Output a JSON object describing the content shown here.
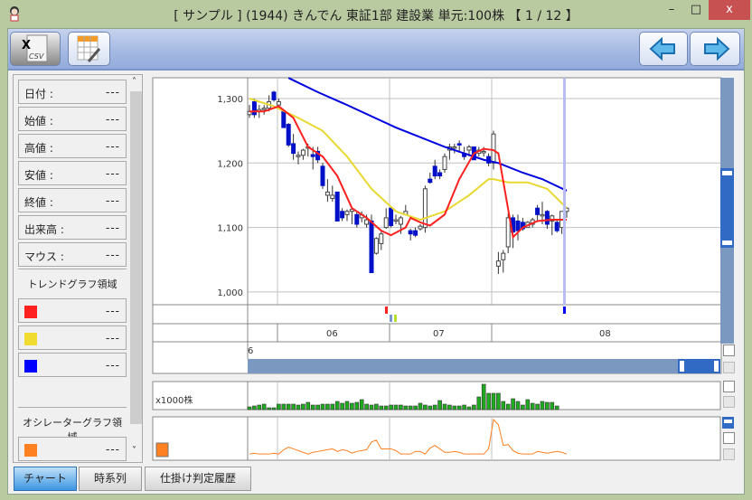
{
  "window": {
    "title": "[ サンプル ] (1944) きんでん 東証1部 建設業 単元:100株 【 1 / 12 】",
    "min": "–",
    "max": "□",
    "close": "x"
  },
  "toolbar": {
    "buttons": [
      {
        "name": "csv-export",
        "icon": "excel-csv-icon",
        "label": "CSV"
      },
      {
        "name": "table",
        "icon": "spreadsheet-edit-icon"
      },
      {
        "name": "prev",
        "icon": "arrow-left-icon"
      },
      {
        "name": "next",
        "icon": "arrow-right-icon"
      }
    ]
  },
  "info": {
    "fields": [
      {
        "label": "日付 :",
        "value": "---"
      },
      {
        "label": "始値 :",
        "value": "---"
      },
      {
        "label": "高値 :",
        "value": "---"
      },
      {
        "label": "安値 :",
        "value": "---"
      },
      {
        "label": "終値 :",
        "value": "---"
      },
      {
        "label": "出来高 :",
        "value": "---"
      },
      {
        "label": "マウス :",
        "value": "---"
      }
    ],
    "trend_title": "トレンドグラフ領域",
    "trend": [
      {
        "color": "#ff2020",
        "value": "---"
      },
      {
        "color": "#f0dc30",
        "value": "---"
      },
      {
        "color": "#0000ff",
        "value": "---"
      }
    ],
    "osc_title": "オシレーターグラフ領域",
    "osc": [
      {
        "color": "#ff8020",
        "value": "---"
      }
    ]
  },
  "chart": {
    "y_ticks": [
      "1,300",
      "1,200",
      "1,100",
      "1,000"
    ],
    "y_values": [
      1300,
      1200,
      1100,
      1000
    ],
    "months": [
      "06",
      "07",
      "08"
    ],
    "year": "6",
    "volume_label": "x1000株",
    "colors": {
      "ma_short": "#ff2020",
      "ma_mid": "#e8d830",
      "ma_long": "#0000e0",
      "down": "#0010c8",
      "volume": "#1faa1f",
      "osc": "#ff8020"
    },
    "candles": [
      [
        1275,
        1290,
        1270,
        1280
      ],
      [
        1295,
        1300,
        1270,
        1275
      ],
      [
        1280,
        1290,
        1270,
        1283
      ],
      [
        1283,
        1290,
        1275,
        1285
      ],
      [
        1285,
        1305,
        1280,
        1295
      ],
      [
        1310,
        1312,
        1295,
        1298
      ],
      [
        1290,
        1300,
        1285,
        1295
      ],
      [
        1280,
        1283,
        1255,
        1255
      ],
      [
        1260,
        1262,
        1225,
        1228
      ],
      [
        1230,
        1245,
        1205,
        1215
      ],
      [
        1210,
        1218,
        1198,
        1212
      ],
      [
        1212,
        1222,
        1205,
        1220
      ],
      [
        1225,
        1230,
        1210,
        1225
      ],
      [
        1213,
        1225,
        1190,
        1210
      ],
      [
        1218,
        1225,
        1200,
        1205
      ],
      [
        1195,
        1200,
        1160,
        1165
      ],
      [
        1150,
        1175,
        1140,
        1155
      ],
      [
        1145,
        1165,
        1140,
        1150
      ],
      [
        1155,
        1155,
        1110,
        1110
      ],
      [
        1125,
        1130,
        1110,
        1115
      ],
      [
        1120,
        1128,
        1110,
        1125
      ],
      [
        1125,
        1130,
        1105,
        1128
      ],
      [
        1120,
        1125,
        1100,
        1105
      ],
      [
        1115,
        1125,
        1108,
        1120
      ],
      [
        1105,
        1120,
        1100,
        1112
      ],
      [
        1110,
        1120,
        1030,
        1030
      ],
      [
        1060,
        1085,
        1058,
        1083
      ],
      [
        1075,
        1095,
        1065,
        1090
      ],
      [
        1100,
        1130,
        1098,
        1115
      ],
      [
        1130,
        1132,
        1100,
        1103
      ],
      [
        1110,
        1120,
        1105,
        1112
      ],
      [
        1105,
        1118,
        1090,
        1115
      ],
      [
        1120,
        1135,
        1120,
        1125
      ],
      [
        1095,
        1098,
        1080,
        1090
      ],
      [
        1095,
        1100,
        1085,
        1088
      ],
      [
        1098,
        1105,
        1095,
        1102
      ],
      [
        1100,
        1165,
        1092,
        1160
      ],
      [
        1175,
        1185,
        1168,
        1170
      ],
      [
        1195,
        1205,
        1175,
        1180
      ],
      [
        1185,
        1190,
        1175,
        1180
      ],
      [
        1190,
        1215,
        1185,
        1210
      ],
      [
        1220,
        1230,
        1205,
        1225
      ],
      [
        1225,
        1230,
        1215,
        1225
      ],
      [
        1230,
        1235,
        1218,
        1228
      ],
      [
        1215,
        1225,
        1205,
        1210
      ],
      [
        1220,
        1228,
        1210,
        1225
      ],
      [
        1225,
        1225,
        1205,
        1205
      ],
      [
        1215,
        1225,
        1210,
        1220
      ],
      [
        1218,
        1225,
        1210,
        1218
      ],
      [
        1210,
        1215,
        1195,
        1200
      ],
      [
        1200,
        1250,
        1190,
        1245
      ],
      [
        1040,
        1062,
        1028,
        1048
      ],
      [
        1050,
        1065,
        1030,
        1060
      ],
      [
        1070,
        1122,
        1060,
        1115
      ],
      [
        1115,
        1120,
        1068,
        1093
      ],
      [
        1110,
        1120,
        1080,
        1095
      ],
      [
        1108,
        1115,
        1095,
        1098
      ],
      [
        1100,
        1110,
        1100,
        1108
      ],
      [
        1105,
        1115,
        1100,
        1112
      ],
      [
        1130,
        1135,
        1110,
        1120
      ],
      [
        1120,
        1140,
        1105,
        1120
      ],
      [
        1125,
        1127,
        1098,
        1105
      ],
      [
        1110,
        1120,
        1088,
        1118
      ],
      [
        1108,
        1112,
        1092,
        1095
      ],
      [
        1100,
        1125,
        1090,
        1125
      ],
      [
        1125,
        1132,
        1115,
        1130
      ]
    ],
    "ma_short": [
      [
        0,
        1280
      ],
      [
        3,
        1280
      ],
      [
        6,
        1288
      ],
      [
        9,
        1270
      ],
      [
        12,
        1225
      ],
      [
        15,
        1210
      ],
      [
        18,
        1180
      ],
      [
        21,
        1130
      ],
      [
        24,
        1115
      ],
      [
        27,
        1095
      ],
      [
        29,
        1088
      ],
      [
        32,
        1100
      ],
      [
        33,
        1115
      ],
      [
        35,
        1108
      ],
      [
        37,
        1103
      ],
      [
        40,
        1120
      ],
      [
        43,
        1175
      ],
      [
        46,
        1215
      ],
      [
        48,
        1222
      ],
      [
        50,
        1220
      ],
      [
        51,
        1215
      ],
      [
        54,
        1085
      ],
      [
        56,
        1100
      ],
      [
        59,
        1110
      ],
      [
        62,
        1112
      ],
      [
        65,
        1112
      ]
    ],
    "ma_mid": [
      [
        0,
        1300
      ],
      [
        5,
        1288
      ],
      [
        10,
        1270
      ],
      [
        15,
        1250
      ],
      [
        20,
        1210
      ],
      [
        25,
        1160
      ],
      [
        30,
        1125
      ],
      [
        35,
        1112
      ],
      [
        40,
        1125
      ],
      [
        45,
        1150
      ],
      [
        49,
        1175
      ],
      [
        50,
        1175
      ],
      [
        53,
        1170
      ],
      [
        57,
        1170
      ],
      [
        61,
        1160
      ],
      [
        65,
        1130
      ]
    ],
    "ma_long": [
      [
        8,
        1332
      ],
      [
        14,
        1310
      ],
      [
        20,
        1290
      ],
      [
        30,
        1255
      ],
      [
        40,
        1225
      ],
      [
        48,
        1205
      ],
      [
        51,
        1200
      ],
      [
        56,
        1185
      ],
      [
        60,
        1175
      ],
      [
        65,
        1157
      ]
    ],
    "volume": [
      3,
      4,
      5,
      6,
      2,
      2,
      6,
      6,
      6,
      6,
      5,
      6,
      8,
      5,
      5,
      6,
      6,
      6,
      9,
      7,
      9,
      7,
      8,
      11,
      6,
      5,
      6,
      4,
      4,
      5,
      5,
      5,
      4,
      4,
      4,
      7,
      5,
      4,
      5,
      10,
      6,
      5,
      4,
      4,
      5,
      3,
      5,
      14,
      28,
      18,
      18,
      18,
      9,
      6,
      12,
      9,
      5,
      11,
      7,
      6,
      9,
      8,
      8,
      4
    ],
    "oscillator": [
      4,
      5,
      4,
      4,
      4,
      5,
      4,
      9,
      12,
      10,
      8,
      6,
      4,
      6,
      7,
      8,
      9,
      10,
      7,
      9,
      8,
      5,
      7,
      8,
      9,
      18,
      20,
      10,
      10,
      10,
      8,
      4,
      4,
      4,
      7,
      7,
      4,
      11,
      14,
      10,
      6,
      6,
      7,
      6,
      4,
      4,
      4,
      4,
      4,
      10,
      44,
      38,
      14,
      15,
      8,
      5,
      4,
      4,
      4,
      7,
      6,
      5,
      6,
      7,
      6,
      4
    ]
  },
  "tabs": [
    {
      "label": "チャート",
      "active": true
    },
    {
      "label": "時系列"
    },
    {
      "label": "仕掛け判定履歴"
    }
  ]
}
